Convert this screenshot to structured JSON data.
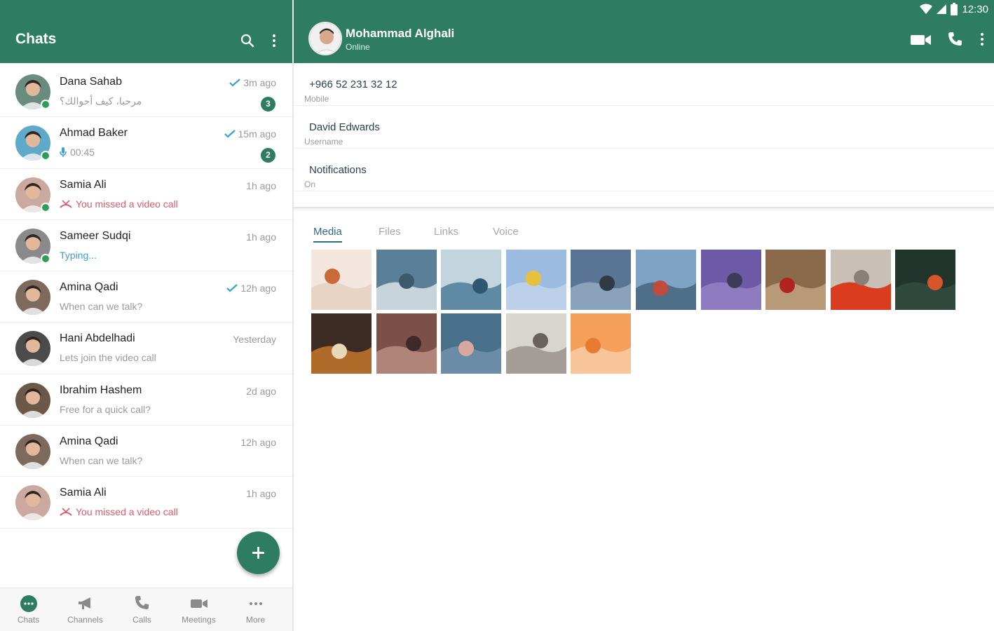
{
  "status_bar": {
    "time": "12:30"
  },
  "left_panel": {
    "title": "Chats",
    "chats": [
      {
        "name": "Dana Sahab",
        "message": "مرحبا، كيف أحوالك؟",
        "time": "3m ago",
        "read_check": true,
        "unread": "3",
        "online": true,
        "message_type": "text",
        "avatar_color": "#6a8c7e"
      },
      {
        "name": "Ahmad Baker",
        "message": "00:45",
        "time": "15m ago",
        "read_check": true,
        "unread": "2",
        "online": true,
        "message_type": "voice",
        "avatar_color": "#5fa9c9"
      },
      {
        "name": "Samia Ali",
        "message": "You missed a video call",
        "time": "1h ago",
        "read_check": false,
        "unread": "",
        "online": true,
        "message_type": "missed",
        "avatar_color": "#c9a9a0"
      },
      {
        "name": "Sameer Sudqi",
        "message": "Typing...",
        "time": "1h ago",
        "read_check": false,
        "unread": "",
        "online": true,
        "message_type": "typing",
        "avatar_color": "#8a8a8a"
      },
      {
        "name": "Amina Qadi",
        "message": "When can we talk?",
        "time": "12h ago",
        "read_check": true,
        "unread": "",
        "online": false,
        "message_type": "text",
        "avatar_color": "#7d6a5c"
      },
      {
        "name": "Hani Abdelhadi",
        "message": "Lets join the video call",
        "time": "Yesterday",
        "read_check": false,
        "unread": "",
        "online": false,
        "message_type": "text",
        "avatar_color": "#4b4b4b"
      },
      {
        "name": "Ibrahim Hashem",
        "message": "Free for a quick call?",
        "time": "2d ago",
        "read_check": false,
        "unread": "",
        "online": false,
        "message_type": "text",
        "avatar_color": "#6b5848"
      },
      {
        "name": "Amina Qadi",
        "message": "When can we talk?",
        "time": "12h ago",
        "read_check": false,
        "unread": "",
        "online": false,
        "message_type": "text",
        "avatar_color": "#7d6a5c"
      },
      {
        "name": "Samia Ali",
        "message": "You missed a video call",
        "time": "1h ago",
        "read_check": false,
        "unread": "",
        "online": false,
        "message_type": "missed",
        "avatar_color": "#c9a9a0"
      }
    ],
    "bottom_nav": [
      {
        "label": "Chats",
        "icon": "chat-bubble-icon"
      },
      {
        "label": "Channels",
        "icon": "megaphone-icon"
      },
      {
        "label": "Calls",
        "icon": "phone-icon"
      },
      {
        "label": "Meetings",
        "icon": "video-camera-icon"
      },
      {
        "label": "More",
        "icon": "more-dots-icon"
      }
    ]
  },
  "right_panel": {
    "contact_name": "Mohammad Alghali",
    "contact_status": "Online",
    "info": [
      {
        "value": "+966 52 231 32 12",
        "label": "Mobile"
      },
      {
        "value": "David Edwards",
        "label": "Username"
      },
      {
        "value": "Notifications",
        "label": "On"
      }
    ],
    "tabs": [
      "Media",
      "Files",
      "Links",
      "Voice"
    ],
    "active_tab": "Media",
    "media": [
      {
        "icon": "child-photo",
        "colors": [
          "#f2e6de",
          "#e8d4c4",
          "#c86a3a"
        ]
      },
      {
        "icon": "harbor-photo",
        "colors": [
          "#5a7f98",
          "#c8d4dc",
          "#3c5a6e"
        ]
      },
      {
        "icon": "sea-photo",
        "colors": [
          "#c2d4de",
          "#5f8aa3",
          "#2f5870"
        ]
      },
      {
        "icon": "flower-photo",
        "colors": [
          "#9bbbe0",
          "#bcd0ea",
          "#e7c13a"
        ]
      },
      {
        "icon": "palm-photo",
        "colors": [
          "#5a7594",
          "#8aa2ba",
          "#2f3a45"
        ]
      },
      {
        "icon": "pier-photo",
        "colors": [
          "#7fa3c4",
          "#4f6f88",
          "#c24a3a"
        ]
      },
      {
        "icon": "lavender-photo",
        "colors": [
          "#6d5aa6",
          "#8f7bc0",
          "#3d3b5a"
        ]
      },
      {
        "icon": "cherries-photo",
        "colors": [
          "#8a6a4a",
          "#b89a78",
          "#b0231f"
        ]
      },
      {
        "icon": "red-door-photo",
        "colors": [
          "#c8c0b6",
          "#d93c1f",
          "#8a8078"
        ]
      },
      {
        "icon": "chili-photo",
        "colors": [
          "#20352c",
          "#2f4a3c",
          "#d6552a"
        ]
      },
      {
        "icon": "food-photo",
        "colors": [
          "#3b2b22",
          "#b06a2a",
          "#e8d8b8"
        ]
      },
      {
        "icon": "rock-photo",
        "colors": [
          "#7a5048",
          "#b08478",
          "#3e2a28"
        ]
      },
      {
        "icon": "water-photo",
        "colors": [
          "#48708a",
          "#6a8ca6",
          "#d8a8a0"
        ]
      },
      {
        "icon": "cat-photo",
        "colors": [
          "#d8d4d0",
          "#a49c96",
          "#6a625c"
        ]
      },
      {
        "icon": "jellyfish-photo",
        "colors": [
          "#f4a05a",
          "#f8c49a",
          "#e87a32"
        ]
      }
    ]
  },
  "colors": {
    "primary": "#2e7d62",
    "missed": "#e0596b",
    "typing": "#3aa0d8",
    "check": "#3aa0d8"
  }
}
